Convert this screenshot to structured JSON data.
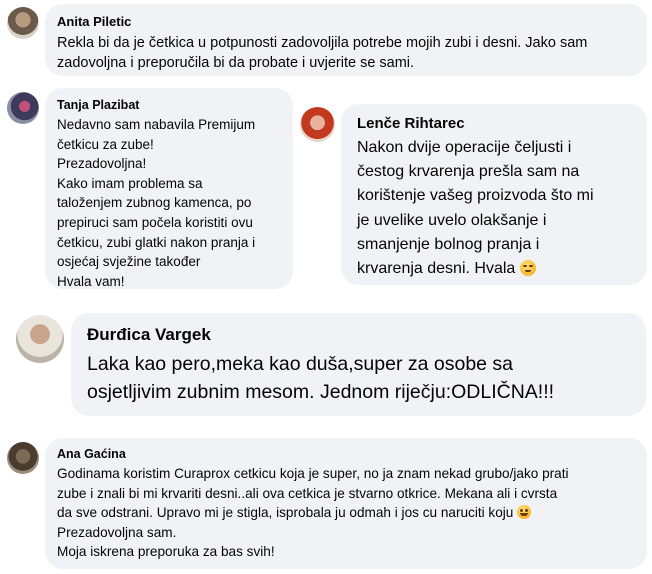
{
  "comments": [
    {
      "author": "Anita Piletic",
      "text": "Rekla bi da je četkica u potpunosti zadovoljila potrebe mojih zubi i desni. Jako sam\nzadovoljna i preporučila bi da probate i uvjerite se sami."
    },
    {
      "author": "Tanja Plazibat",
      "text": "Nedavno sam nabavila Premijum\nčetkicu za zube!\nPrezadovoljna!\nKako imam problema sa\ntaloženjem zubnog kamenca, po\nprepiruci sam počela koristiti ovu\nčetkicu, zubi glatki nakon pranja i\nosjećaj svježine također\nHvala vam!"
    },
    {
      "author": "Lenče Rihtarec",
      "text": "Nakon dvije operacije čeljusti i\nčestog krvarenja prešla sam na\nkorištenje vašeg proizvoda što mi\nje uvelike uvelo olakšanje i\nsmanjenje bolnog pranja i\nkrvarenja desni. Hvala",
      "emoji": "relieved-face-emoji"
    },
    {
      "author": "Đurđica Vargek",
      "text": "Laka kao pero,meka kao duša,super za osobe sa\nosjetljivim zubnim mesom. Jednom riječju:ODLIČNA!!!"
    },
    {
      "author": "Ana Gaćina",
      "text_before": "Godinama koristim Curaprox cetkicu koja je super, no ja znam nekad grubo/jako prati\nzube i znali bi mi krvariti desni..ali ova cetkica je stvarno otkrice. Mekana ali i cvrsta\nda sve odstrani. Upravo mi je stigla, isprobala ju odmah i jos cu naruciti koju",
      "emoji": "smiling-face-emoji",
      "text_after": "Prezadovoljna sam.\nMoja iskrena preporuka za bas svih!"
    }
  ],
  "colors": {
    "bubble": "#f0f2f5",
    "text": "#050505",
    "emoji_yellow": "#f5b62a"
  }
}
